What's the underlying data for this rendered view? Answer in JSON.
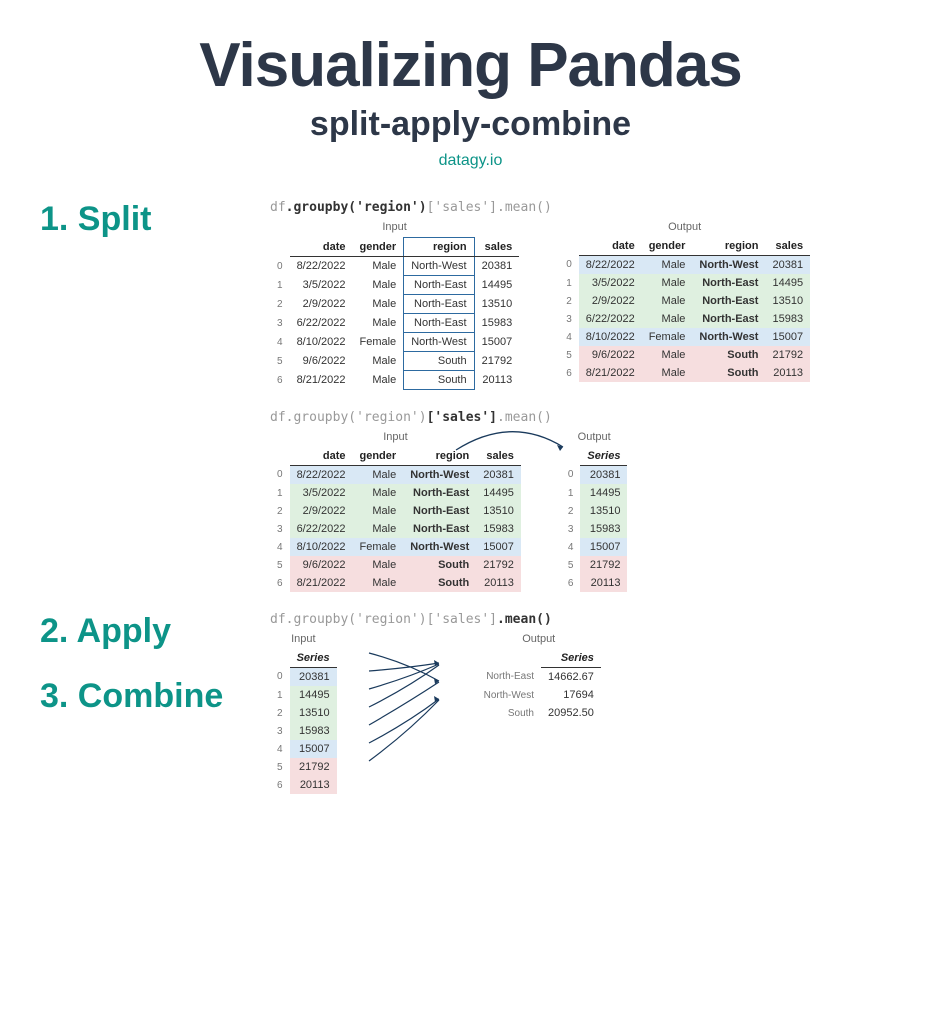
{
  "header": {
    "title": "Visualizing Pandas",
    "subtitle": "split-apply-combine",
    "site": "datagy.io"
  },
  "steps": {
    "split": "1. Split",
    "apply": "2. Apply",
    "combine": "3. Combine"
  },
  "labels": {
    "input": "Input",
    "output": "Output",
    "series": "Series"
  },
  "columns": [
    "date",
    "gender",
    "region",
    "sales"
  ],
  "rows": [
    {
      "idx": "0",
      "date": "8/22/2022",
      "gender": "Male",
      "region": "North-West",
      "sales": "20381",
      "group": "blue"
    },
    {
      "idx": "1",
      "date": "3/5/2022",
      "gender": "Male",
      "region": "North-East",
      "sales": "14495",
      "group": "green"
    },
    {
      "idx": "2",
      "date": "2/9/2022",
      "gender": "Male",
      "region": "North-East",
      "sales": "13510",
      "group": "green"
    },
    {
      "idx": "3",
      "date": "6/22/2022",
      "gender": "Male",
      "region": "North-East",
      "sales": "15983",
      "group": "green"
    },
    {
      "idx": "4",
      "date": "8/10/2022",
      "gender": "Female",
      "region": "North-West",
      "sales": "15007",
      "group": "blue"
    },
    {
      "idx": "5",
      "date": "9/6/2022",
      "gender": "Male",
      "region": "South",
      "sales": "21792",
      "group": "pink"
    },
    {
      "idx": "6",
      "date": "8/21/2022",
      "gender": "Male",
      "region": "South",
      "sales": "20113",
      "group": "pink"
    }
  ],
  "combine_output": [
    {
      "region": "North-East",
      "value": "14662.67"
    },
    {
      "region": "North-West",
      "value": "17694"
    },
    {
      "region": "South",
      "value": "20952.50"
    }
  ],
  "code": {
    "pre": "df",
    "groupby": ".groupby('",
    "region": "region",
    "after_region": "')",
    "sales_open": "['",
    "sales": "sales",
    "sales_close": "']",
    "mean": ".mean()"
  }
}
